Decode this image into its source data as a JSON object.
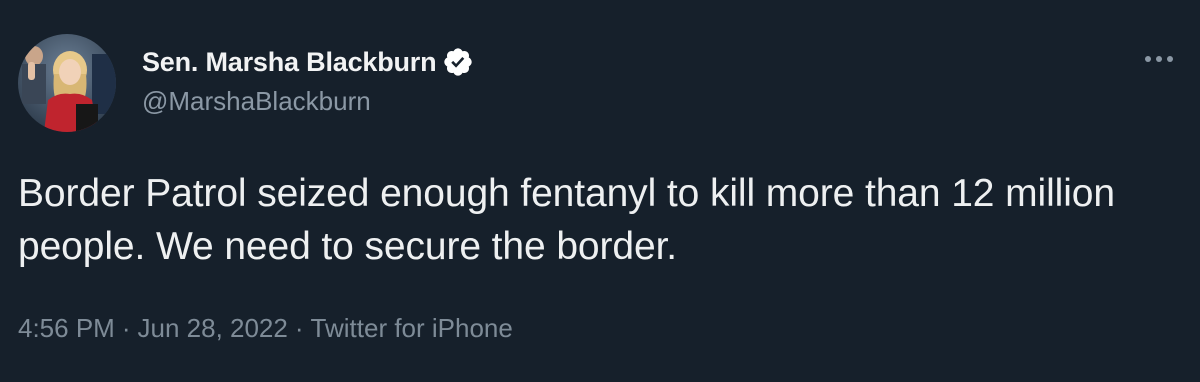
{
  "author": {
    "display_name": "Sen. Marsha Blackburn",
    "handle": "@MarshaBlackburn",
    "verified": true,
    "verified_icon": "verified-badge-icon",
    "avatar_icon": "profile-avatar"
  },
  "tweet": {
    "text": "Border Patrol seized enough fentanyl to kill more than 12 million people. We need to secure the border."
  },
  "meta": {
    "time": "4:56 PM",
    "separator": "·",
    "date": "Jun 28, 2022",
    "source": "Twitter for iPhone"
  },
  "menu": {
    "icon": "more-options-icon"
  },
  "colors": {
    "background": "#16202b",
    "text_primary": "#e7e9ea",
    "text_secondary": "#8b98a5",
    "verified_fill": "#ffffff"
  }
}
